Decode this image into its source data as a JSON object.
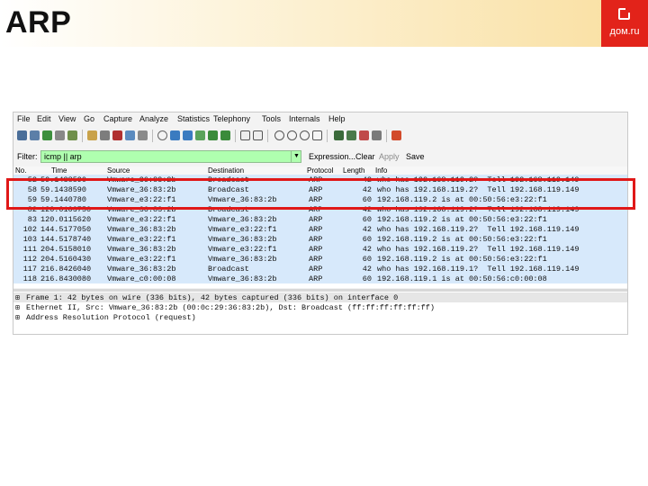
{
  "slide": {
    "title": "ARP",
    "logo_text": "дом.ru"
  },
  "menu": [
    "File",
    "Edit",
    "View",
    "Go",
    "Capture",
    "Analyze",
    "Statistics",
    "Telephony",
    "Tools",
    "Internals",
    "Help"
  ],
  "filter": {
    "label": "Filter:",
    "value": "icmp || arp",
    "expression": "Expression...",
    "clear": "Clear",
    "apply": "Apply",
    "save": "Save"
  },
  "columns": {
    "no": "No.",
    "time": "Time",
    "source": "Source",
    "destination": "Destination",
    "protocol": "Protocol",
    "length": "Length",
    "info": "Info"
  },
  "packets": [
    {
      "no": "52",
      "time": "59.1438590",
      "source": "Vmware_36:83:2b",
      "destination": "Broadcast",
      "protocol": "ARP",
      "length": "42",
      "info": "who has 192.168.119.2?  Tell 192.168.119.149"
    },
    {
      "no": "58",
      "time": "59.1438590",
      "source": "Vmware_36:83:2b",
      "destination": "Broadcast",
      "protocol": "ARP",
      "length": "42",
      "info": "who has 192.168.119.2?  Tell 192.168.119.149"
    },
    {
      "no": "59",
      "time": "59.1440780",
      "source": "Vmware_e3:22:f1",
      "destination": "Vmware_36:83:2b",
      "protocol": "ARP",
      "length": "60",
      "info": "192.168.119.2 is at 00:50:56:e3:22:f1"
    },
    {
      "no": "82",
      "time": "120.0103750",
      "source": "Vmware_36:83:2b",
      "destination": "Broadcast",
      "protocol": "ARP",
      "length": "42",
      "info": "who has 192.168.119.2?  Tell 192.168.119.149"
    },
    {
      "no": "83",
      "time": "120.0115620",
      "source": "Vmware_e3:22:f1",
      "destination": "Vmware_36:83:2b",
      "protocol": "ARP",
      "length": "60",
      "info": "192.168.119.2 is at 00:50:56:e3:22:f1"
    },
    {
      "no": "102",
      "time": "144.5177050",
      "source": "Vmware_36:83:2b",
      "destination": "Vmware_e3:22:f1",
      "protocol": "ARP",
      "length": "42",
      "info": "who has 192.168.119.2?  Tell 192.168.119.149"
    },
    {
      "no": "103",
      "time": "144.5178740",
      "source": "Vmware_e3:22:f1",
      "destination": "Vmware_36:83:2b",
      "protocol": "ARP",
      "length": "60",
      "info": "192.168.119.2 is at 00:50:56:e3:22:f1"
    },
    {
      "no": "111",
      "time": "204.5158010",
      "source": "Vmware_36:83:2b",
      "destination": "Vmware_e3:22:f1",
      "protocol": "ARP",
      "length": "42",
      "info": "who has 192.168.119.2?  Tell 192.168.119.149"
    },
    {
      "no": "112",
      "time": "204.5160430",
      "source": "Vmware_e3:22:f1",
      "destination": "Vmware_36:83:2b",
      "protocol": "ARP",
      "length": "60",
      "info": "192.168.119.2 is at 00:50:56:e3:22:f1"
    },
    {
      "no": "117",
      "time": "216.8426040",
      "source": "Vmware_36:83:2b",
      "destination": "Broadcast",
      "protocol": "ARP",
      "length": "42",
      "info": "who has 192.168.119.1?  Tell 192.168.119.149"
    },
    {
      "no": "118",
      "time": "216.8430080",
      "source": "Vmware_c0:00:08",
      "destination": "Vmware_36:83:2b",
      "protocol": "ARP",
      "length": "60",
      "info": "192.168.119.1 is at 00:50:56:c0:00:08"
    }
  ],
  "details": [
    {
      "expander": "⊞",
      "text": "Frame 1: 42 bytes on wire (336 bits), 42 bytes captured (336 bits) on interface 0"
    },
    {
      "expander": "⊞",
      "text": "Ethernet II, Src: Vmware_36:83:2b (00:0c:29:36:83:2b), Dst: Broadcast (ff:ff:ff:ff:ff:ff)"
    },
    {
      "expander": "⊞",
      "text": "Address Resolution Protocol (request)"
    }
  ]
}
